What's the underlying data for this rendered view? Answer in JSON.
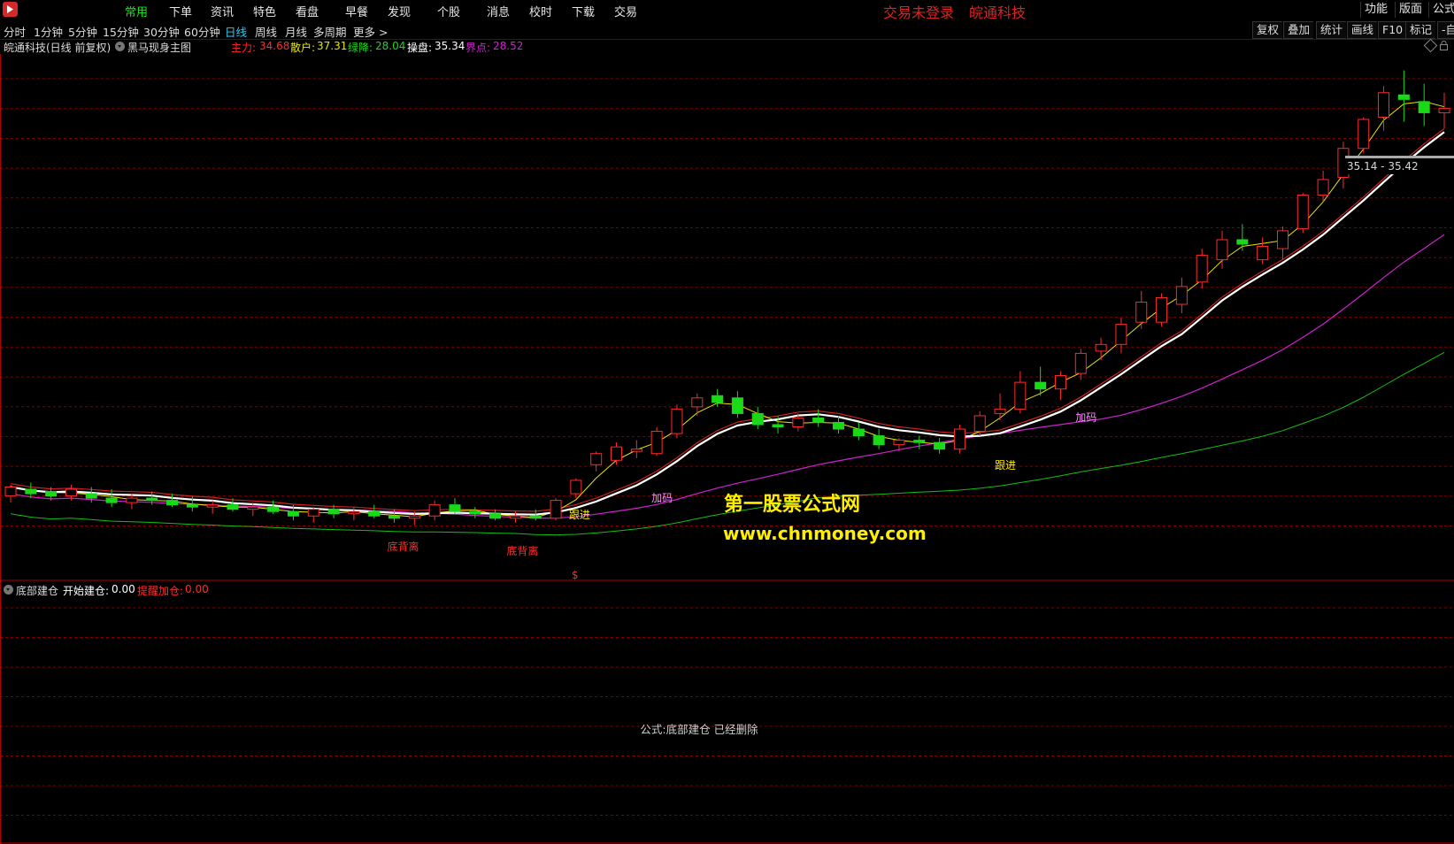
{
  "menubar": {
    "items": [
      "常用",
      "下单",
      "资讯",
      "特色",
      "看盘",
      "早餐",
      "发现",
      "个股",
      "消息",
      "校时",
      "下载",
      "交易"
    ],
    "active_index": 0,
    "status_login": "交易未登录",
    "status_stock": "皖通科技",
    "right_buttons": [
      "功能",
      "版面",
      "公式"
    ]
  },
  "periodbar": {
    "periods": [
      "分时",
      "1分钟",
      "5分钟",
      "15分钟",
      "30分钟",
      "60分钟",
      "日线",
      "周线",
      "月线",
      "多周期",
      "更多 >"
    ],
    "active_index": 6,
    "tools": [
      "复权",
      "叠加",
      "统计",
      "画线",
      "F10",
      "标记",
      "-自"
    ]
  },
  "info": {
    "stock_title": "皖通科技(日线 前复权)",
    "formula_name": "黑马现身主图",
    "zhuli_label": "主力:",
    "zhuli_value": "34.68",
    "sanhu_label": "散户:",
    "sanhu_value": "37.31",
    "lvjiang_label": "绿降:",
    "lvjiang_value": "28.04",
    "caopan_label": "操盘:",
    "caopan_value": "35.34",
    "jiedian_label": "界点:",
    "jiedian_value": "28.52"
  },
  "annotations": {
    "gen_jin": "跟进",
    "jia_ma": "加码",
    "di_bei_li": "底背离",
    "dollar": "$",
    "range_text": "35.14 - 35.42"
  },
  "watermark": {
    "line1": "第一股票公式网",
    "line2": "www.chnmoney.com"
  },
  "subpanel": {
    "formula_name": "底部建仓",
    "kaishi_label": "开始建仓:",
    "kaishi_value": "0.00",
    "tixing_label": "提醒加仓:",
    "tixing_value": "0.00",
    "deleted_msg": "公式:底部建仓 已经删除"
  },
  "colors": {
    "up": "#ff2a2a",
    "down": "#19d919",
    "white_line": "#ffffff",
    "yellow_line": "#e6e600",
    "red_line": "#cc2020",
    "magenta_line": "#d020d0",
    "green_line": "#10c010",
    "grid": "#7a0000"
  },
  "chart_data": {
    "type": "candlestick",
    "candles": [
      {
        "o": 20.4,
        "h": 20.9,
        "l": 20.1,
        "c": 20.8
      },
      {
        "o": 20.7,
        "h": 21.0,
        "l": 20.3,
        "c": 20.5
      },
      {
        "o": 20.6,
        "h": 20.8,
        "l": 20.2,
        "c": 20.4
      },
      {
        "o": 20.4,
        "h": 20.9,
        "l": 20.2,
        "c": 20.7
      },
      {
        "o": 20.5,
        "h": 20.8,
        "l": 20.1,
        "c": 20.3
      },
      {
        "o": 20.3,
        "h": 20.7,
        "l": 19.9,
        "c": 20.1
      },
      {
        "o": 20.1,
        "h": 20.5,
        "l": 19.8,
        "c": 20.3
      },
      {
        "o": 20.3,
        "h": 20.6,
        "l": 20.0,
        "c": 20.2
      },
      {
        "o": 20.2,
        "h": 20.5,
        "l": 19.9,
        "c": 20.0
      },
      {
        "o": 20.0,
        "h": 20.4,
        "l": 19.7,
        "c": 19.9
      },
      {
        "o": 19.9,
        "h": 20.2,
        "l": 19.6,
        "c": 20.0
      },
      {
        "o": 20.0,
        "h": 20.3,
        "l": 19.7,
        "c": 19.8
      },
      {
        "o": 19.8,
        "h": 20.1,
        "l": 19.5,
        "c": 19.9
      },
      {
        "o": 19.9,
        "h": 20.2,
        "l": 19.6,
        "c": 19.7
      },
      {
        "o": 19.7,
        "h": 20.0,
        "l": 19.3,
        "c": 19.5
      },
      {
        "o": 19.5,
        "h": 19.9,
        "l": 19.2,
        "c": 19.8
      },
      {
        "o": 19.8,
        "h": 20.0,
        "l": 19.4,
        "c": 19.6
      },
      {
        "o": 19.6,
        "h": 19.9,
        "l": 19.3,
        "c": 19.7
      },
      {
        "o": 19.7,
        "h": 20.0,
        "l": 19.4,
        "c": 19.5
      },
      {
        "o": 19.5,
        "h": 19.8,
        "l": 19.2,
        "c": 19.4
      },
      {
        "o": 19.4,
        "h": 19.7,
        "l": 19.1,
        "c": 19.5
      },
      {
        "o": 19.5,
        "h": 20.2,
        "l": 19.3,
        "c": 20.0
      },
      {
        "o": 20.0,
        "h": 20.3,
        "l": 19.6,
        "c": 19.7
      },
      {
        "o": 19.7,
        "h": 19.9,
        "l": 19.4,
        "c": 19.6
      },
      {
        "o": 19.6,
        "h": 19.8,
        "l": 19.3,
        "c": 19.4
      },
      {
        "o": 19.4,
        "h": 19.7,
        "l": 19.2,
        "c": 19.5
      },
      {
        "o": 19.5,
        "h": 19.8,
        "l": 19.3,
        "c": 19.4
      },
      {
        "o": 19.4,
        "h": 20.3,
        "l": 19.3,
        "c": 20.2
      },
      {
        "o": 20.5,
        "h": 21.2,
        "l": 20.3,
        "c": 21.1
      },
      {
        "o": 21.8,
        "h": 22.4,
        "l": 21.5,
        "c": 22.3
      },
      {
        "o": 22.0,
        "h": 22.8,
        "l": 21.8,
        "c": 22.6
      },
      {
        "o": 22.4,
        "h": 22.9,
        "l": 22.1,
        "c": 22.5
      },
      {
        "o": 22.3,
        "h": 23.5,
        "l": 22.2,
        "c": 23.3
      },
      {
        "o": 23.2,
        "h": 24.5,
        "l": 23.0,
        "c": 24.3
      },
      {
        "o": 24.4,
        "h": 25.0,
        "l": 24.0,
        "c": 24.8
      },
      {
        "o": 24.9,
        "h": 25.2,
        "l": 24.4,
        "c": 24.6
      },
      {
        "o": 24.8,
        "h": 25.1,
        "l": 23.9,
        "c": 24.1
      },
      {
        "o": 24.1,
        "h": 24.4,
        "l": 23.4,
        "c": 23.6
      },
      {
        "o": 23.6,
        "h": 24.0,
        "l": 23.2,
        "c": 23.5
      },
      {
        "o": 23.5,
        "h": 24.1,
        "l": 23.3,
        "c": 23.9
      },
      {
        "o": 23.9,
        "h": 24.3,
        "l": 23.5,
        "c": 23.7
      },
      {
        "o": 23.7,
        "h": 24.0,
        "l": 23.2,
        "c": 23.4
      },
      {
        "o": 23.4,
        "h": 23.7,
        "l": 22.9,
        "c": 23.1
      },
      {
        "o": 23.1,
        "h": 23.4,
        "l": 22.5,
        "c": 22.7
      },
      {
        "o": 22.7,
        "h": 23.0,
        "l": 22.4,
        "c": 22.9
      },
      {
        "o": 22.9,
        "h": 23.1,
        "l": 22.5,
        "c": 22.8
      },
      {
        "o": 22.8,
        "h": 23.0,
        "l": 22.3,
        "c": 22.5
      },
      {
        "o": 22.5,
        "h": 23.6,
        "l": 22.3,
        "c": 23.4
      },
      {
        "o": 23.3,
        "h": 24.2,
        "l": 23.1,
        "c": 24.0
      },
      {
        "o": 24.1,
        "h": 25.0,
        "l": 23.8,
        "c": 24.3
      },
      {
        "o": 24.3,
        "h": 26.0,
        "l": 24.1,
        "c": 25.5
      },
      {
        "o": 25.5,
        "h": 26.2,
        "l": 24.9,
        "c": 25.2
      },
      {
        "o": 25.2,
        "h": 26.0,
        "l": 24.7,
        "c": 25.8
      },
      {
        "o": 25.9,
        "h": 27.0,
        "l": 25.6,
        "c": 26.8
      },
      {
        "o": 26.9,
        "h": 27.5,
        "l": 26.5,
        "c": 27.2
      },
      {
        "o": 27.2,
        "h": 28.4,
        "l": 26.8,
        "c": 28.1
      },
      {
        "o": 28.2,
        "h": 29.6,
        "l": 27.9,
        "c": 29.1
      },
      {
        "o": 28.2,
        "h": 29.5,
        "l": 28.0,
        "c": 29.3
      },
      {
        "o": 29.0,
        "h": 30.2,
        "l": 28.6,
        "c": 29.8
      },
      {
        "o": 30.0,
        "h": 31.5,
        "l": 29.7,
        "c": 31.2
      },
      {
        "o": 31.0,
        "h": 32.3,
        "l": 30.6,
        "c": 31.9
      },
      {
        "o": 31.9,
        "h": 32.6,
        "l": 31.4,
        "c": 31.7
      },
      {
        "o": 31.0,
        "h": 32.0,
        "l": 30.8,
        "c": 31.6
      },
      {
        "o": 31.5,
        "h": 32.5,
        "l": 31.0,
        "c": 32.3
      },
      {
        "o": 32.4,
        "h": 34.0,
        "l": 32.2,
        "c": 33.9
      },
      {
        "o": 33.9,
        "h": 35.0,
        "l": 33.6,
        "c": 34.6
      },
      {
        "o": 34.7,
        "h": 36.3,
        "l": 34.2,
        "c": 36.0
      },
      {
        "o": 36.0,
        "h": 37.4,
        "l": 35.8,
        "c": 37.3
      },
      {
        "o": 37.4,
        "h": 38.8,
        "l": 36.8,
        "c": 38.5
      },
      {
        "o": 38.4,
        "h": 39.5,
        "l": 37.2,
        "c": 38.2
      },
      {
        "o": 38.1,
        "h": 38.9,
        "l": 37.0,
        "c": 37.6
      },
      {
        "o": 37.6,
        "h": 38.5,
        "l": 36.9,
        "c": 37.8
      }
    ],
    "yrange": [
      18,
      40
    ]
  }
}
